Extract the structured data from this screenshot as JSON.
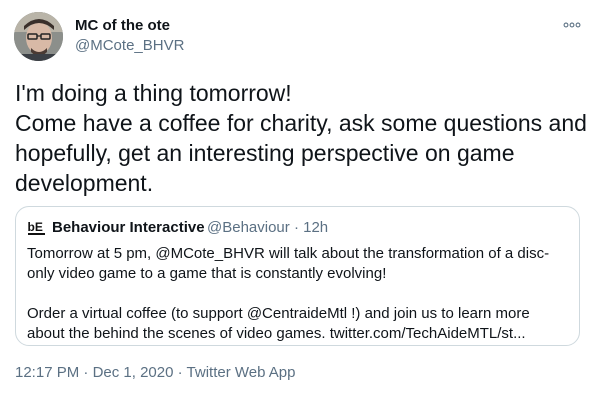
{
  "author": {
    "display_name": "MC of the ote",
    "handle": "@MCote_BHVR",
    "avatar_icon": "avatar-photo"
  },
  "tweet": {
    "lines": [
      "I'm doing a thing tomorrow!",
      "Come have a coffee for charity, ask some questions and",
      "hopefully, get an interesting perspective on game",
      "development."
    ]
  },
  "quoted": {
    "logo_text": "bE",
    "display_name": "Behaviour Interactive",
    "handle": "@Behaviour",
    "separator": "·",
    "time": "12h",
    "lines": [
      "Tomorrow at 5 pm, @MCote_BHVR will talk about the transformation of a disc-",
      "only video game to a game that is constantly evolving!",
      "",
      "Order a virtual coffee (to support @CentraideMtl !) and join us to learn more",
      "about the behind the scenes of video games. twitter.com/TechAideMTL/st..."
    ]
  },
  "meta": {
    "time": "12:17 PM",
    "date": "Dec 1, 2020",
    "source": "Twitter Web App",
    "separator": "·"
  },
  "colors": {
    "text": "#0f1419",
    "secondary": "#5b7083",
    "border": "#cfd9de"
  }
}
